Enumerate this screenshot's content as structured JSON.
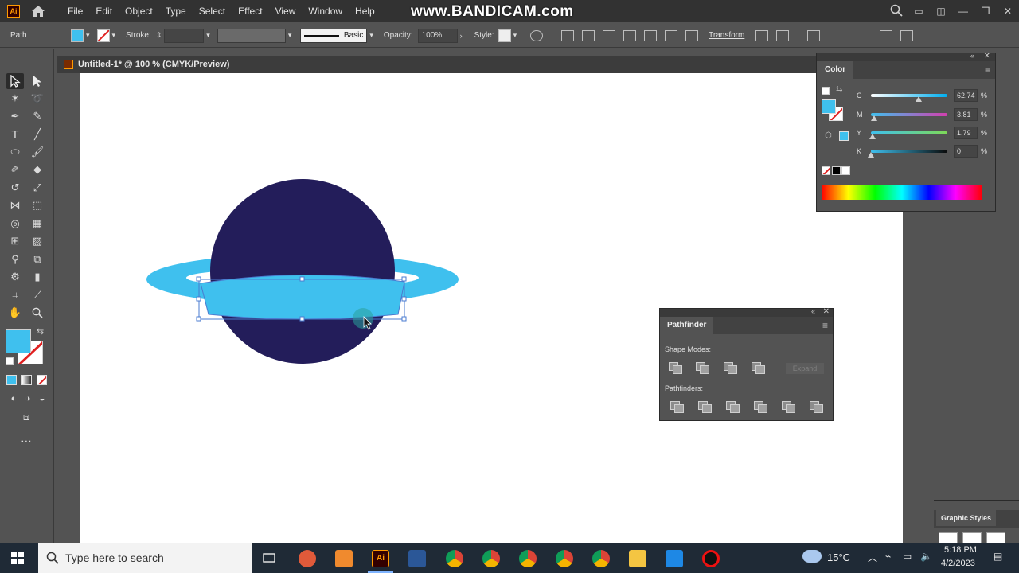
{
  "app": {
    "logo": "Ai",
    "menu": [
      "File",
      "Edit",
      "Object",
      "Type",
      "Select",
      "Effect",
      "View",
      "Window",
      "Help"
    ],
    "watermark": "www.BANDICAM.com"
  },
  "controlbar": {
    "selection_type": "Path",
    "stroke_label": "Stroke:",
    "stroke_profile": "Basic",
    "opacity_label": "Opacity:",
    "opacity_value": "100%",
    "style_label": "Style:",
    "transform_label": "Transform"
  },
  "document": {
    "tab_title": "Untitled-1* @ 100 % (CMYK/Preview)"
  },
  "color_panel": {
    "title": "Color",
    "sliders": [
      {
        "label": "C",
        "value": "62.74",
        "fraction": 0.6274
      },
      {
        "label": "M",
        "value": "3.81",
        "fraction": 0.0381
      },
      {
        "label": "Y",
        "value": "1.79",
        "fraction": 0.0179
      },
      {
        "label": "K",
        "value": "0",
        "fraction": 0
      }
    ],
    "pct": "%"
  },
  "pathfinder": {
    "title": "Pathfinder",
    "shape_modes_label": "Shape Modes:",
    "expand_label": "Expand",
    "pathfinders_label": "Pathfinders:"
  },
  "graphic_styles": {
    "title": "Graphic Styles"
  },
  "taskbar": {
    "search_placeholder": "Type here to search",
    "weather": "15°C",
    "time": "5:18 PM",
    "date": "4/2/2023"
  },
  "colors": {
    "fill": "#3fc0ee",
    "planet": "#231d5a",
    "ring": "#3fc0ee",
    "selection": "#4a7bd0"
  }
}
